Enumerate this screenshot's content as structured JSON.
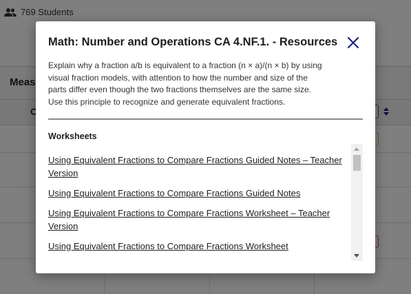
{
  "background": {
    "students_count": "769 Students",
    "measure_label": "Meas",
    "column_label": "O"
  },
  "modal": {
    "title": "Math: Number and Operations CA 4.NF.1. - Resources",
    "description": "Explain why a fraction a/b is equivalent to a fraction (n × a)/(n × b) by using visual fraction models, with attention to how the number and size of the parts differ even though the two fractions themselves are the same size. Use this principle to recognize and generate equivalent fractions.",
    "section_title": "Worksheets",
    "items": [
      {
        "label": "Using Equivalent Fractions to Compare Fractions Guided Notes – Teacher Version"
      },
      {
        "label": "Using Equivalent Fractions to Compare Fractions Guided Notes"
      },
      {
        "label": "Using Equivalent Fractions to Compare Fractions Worksheet – Teacher Version"
      },
      {
        "label": "Using Equivalent Fractions to Compare Fractions Worksheet"
      }
    ],
    "close_icon": "close-icon"
  },
  "colors": {
    "close_icon": "#1a237e",
    "overlay": "rgba(0,0,0,0.5)",
    "badge_orange": "#f0a860",
    "badge_red": "#e05050"
  }
}
